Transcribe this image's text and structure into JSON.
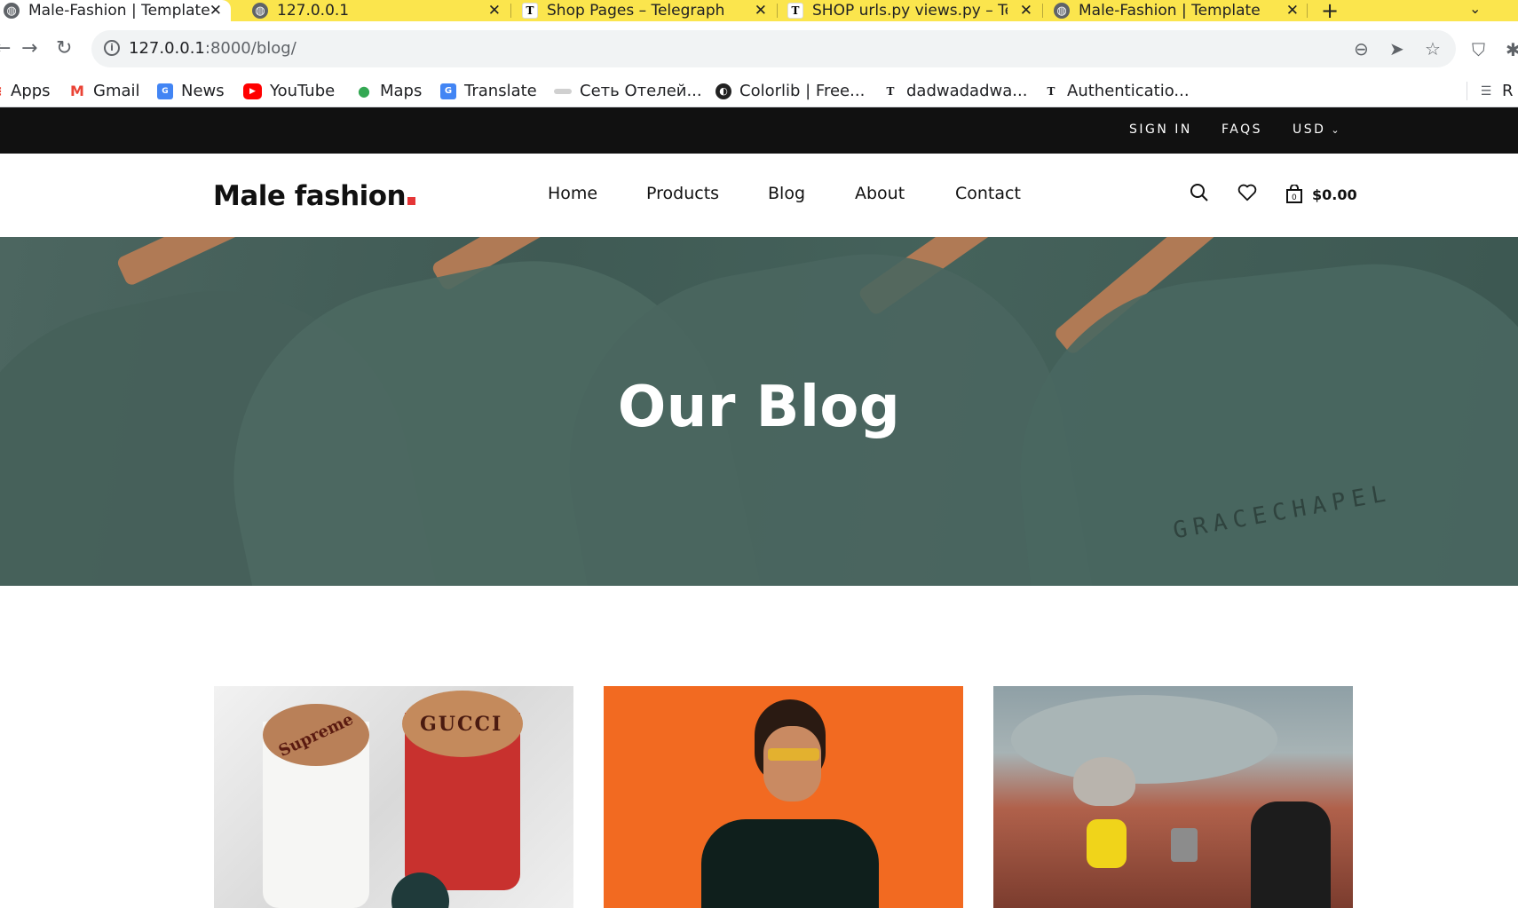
{
  "browser": {
    "tabs": [
      {
        "title": "Male-Fashion | Template",
        "active": true,
        "icon": "globe-icon"
      },
      {
        "title": "127.0.0.1",
        "active": false,
        "icon": "globe-icon"
      },
      {
        "title": "Shop Pages – Telegraph",
        "active": false,
        "icon": "telegraph-icon"
      },
      {
        "title": "SHOP urls.py views.py – Te",
        "active": false,
        "icon": "telegraph-icon"
      },
      {
        "title": "Male-Fashion | Template",
        "active": false,
        "icon": "globe-icon"
      }
    ],
    "new_tab_label": "+",
    "address": {
      "host": "127.0.0.1",
      "rest": ":8000/blog/"
    },
    "bookmarks": [
      {
        "label": "Apps",
        "icon": "apps-grid-icon"
      },
      {
        "label": "Gmail",
        "icon": "gmail-icon"
      },
      {
        "label": "News",
        "icon": "news-icon"
      },
      {
        "label": "YouTube",
        "icon": "youtube-icon"
      },
      {
        "label": "Maps",
        "icon": "maps-icon"
      },
      {
        "label": "Translate",
        "icon": "translate-icon"
      },
      {
        "label": "Сеть Отелей...",
        "icon": "hotel-icon"
      },
      {
        "label": "Colorlib | Free...",
        "icon": "colorlib-icon"
      },
      {
        "label": "dadwadadwa...",
        "icon": "telegraph-icon"
      },
      {
        "label": "Authenticatio...",
        "icon": "telegraph-icon"
      }
    ],
    "reading_list_label": "R"
  },
  "site": {
    "topbar": {
      "sign_in": "SIGN IN",
      "faqs": "FAQS",
      "currency": "USD"
    },
    "logo": {
      "text": "Male fashion",
      "accent": "#e53637"
    },
    "menu": [
      "Home",
      "Products",
      "Blog",
      "About",
      "Contact"
    ],
    "cart_total": "$0.00",
    "cart_count": "0",
    "hero": {
      "title": "Our Blog",
      "shirt_brand": "GRACECHAPEL"
    },
    "cards": [
      {
        "image": "coffee-cups-image",
        "cup1_label": "Supreme",
        "cup2_label": "GUCCI"
      },
      {
        "image": "man-orange-wall-image"
      },
      {
        "image": "camping-kettle-image"
      }
    ]
  },
  "colors": {
    "tabbar": "#fbe54d",
    "topbar": "#111111",
    "accent": "#e53637"
  }
}
